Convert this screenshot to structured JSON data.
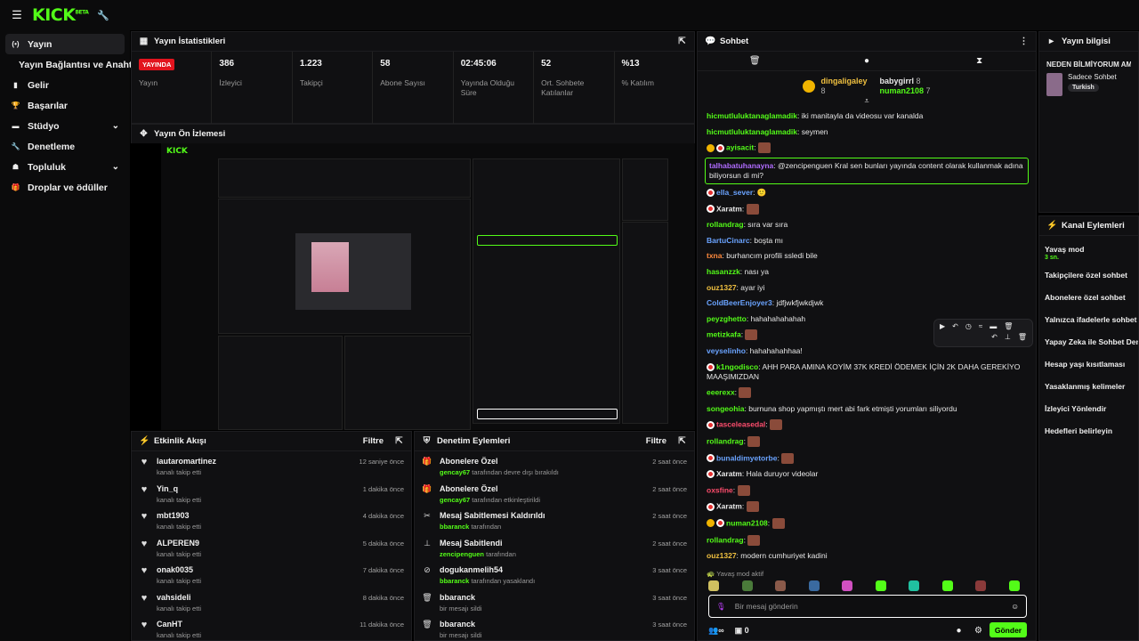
{
  "app": {
    "logo": "KICK",
    "logo_beta": "BETA"
  },
  "sidebar": {
    "items": [
      {
        "label": "Yayın",
        "icon": "broadcast-icon",
        "active": true
      },
      {
        "label": "Yayın Bağlantısı ve Anahtarı",
        "sub": true
      },
      {
        "label": "Gelir",
        "icon": "chart-icon"
      },
      {
        "label": "Başarılar",
        "icon": "trophy-icon"
      },
      {
        "label": "Stüdyo",
        "icon": "studio-icon",
        "chevron": true
      },
      {
        "label": "Denetleme",
        "icon": "wrench-icon"
      },
      {
        "label": "Topluluk",
        "icon": "community-icon",
        "chevron": true
      },
      {
        "label": "Droplar ve ödüller",
        "icon": "gift-icon"
      }
    ]
  },
  "stats_panel": {
    "title": "Yayın İstatistikleri",
    "live_badge": "YAYINDA",
    "items": [
      {
        "value": "",
        "label": "Yayın"
      },
      {
        "value": "386",
        "label": "İzleyici"
      },
      {
        "value": "1.223",
        "label": "Takipçi"
      },
      {
        "value": "58",
        "label": "Abone Sayısı"
      },
      {
        "value": "02:45:06",
        "label": "Yayında Olduğu Süre"
      },
      {
        "value": "52",
        "label": "Ort. Sohbete Katılanlar"
      },
      {
        "value": "%13",
        "label": "% Katılım"
      }
    ]
  },
  "preview_panel": {
    "title": "Yayın Ön İzlemesi"
  },
  "activity_feed": {
    "title": "Etkinlik Akışı",
    "filter": "Filtre",
    "rows": [
      {
        "name": "lautaromartinez",
        "sub": "kanalı takip etti",
        "time": "12 saniye önce"
      },
      {
        "name": "Yin_q",
        "sub": "kanalı takip etti",
        "time": "1 dakika önce"
      },
      {
        "name": "mbt1903",
        "sub": "kanalı takip etti",
        "time": "4 dakika önce"
      },
      {
        "name": "ALPEREN9",
        "sub": "kanalı takip etti",
        "time": "5 dakika önce"
      },
      {
        "name": "onak0035",
        "sub": "kanalı takip etti",
        "time": "7 dakika önce"
      },
      {
        "name": "vahsideli",
        "sub": "kanalı takip etti",
        "time": "8 dakika önce"
      },
      {
        "name": "CanHT",
        "sub": "kanalı takip etti",
        "time": "11 dakika önce"
      }
    ]
  },
  "mod_actions": {
    "title": "Denetim Eylemleri",
    "filter": "Filtre",
    "rows": [
      {
        "icon": "gift-icon",
        "name": "Abonelere Özel",
        "user": "gencay67",
        "sub": "tarafından devre dışı bırakıldı",
        "time": "2 saat önce"
      },
      {
        "icon": "gift-icon",
        "name": "Abonelere Özel",
        "user": "gencay67",
        "sub": "tarafından etkinleştirildi",
        "time": "2 saat önce"
      },
      {
        "icon": "unpin-icon",
        "name": "Mesaj Sabitlemesi Kaldırıldı",
        "user": "bbaranck",
        "sub": "tarafından",
        "time": "2 saat önce"
      },
      {
        "icon": "pin-icon",
        "name": "Mesaj Sabitlendi",
        "user": "zencipenguen",
        "sub": "tarafından",
        "time": "2 saat önce"
      },
      {
        "icon": "ban-icon",
        "name": "dogukanmelih54",
        "user": "bbaranck",
        "sub": "tarafından yasaklandı",
        "time": "3 saat önce"
      },
      {
        "icon": "trash-icon",
        "name": "bbaranck",
        "user": "",
        "sub": "bir mesajı sildi",
        "time": "3 saat önce"
      },
      {
        "icon": "trash-icon",
        "name": "bbaranck",
        "user": "",
        "sub": "bir mesajı sildi",
        "time": "3 saat önce"
      }
    ]
  },
  "chat": {
    "title": "Sohbet",
    "pinned": {
      "top_user": "dingaligaley",
      "top_count": "8",
      "users": [
        {
          "name": "babygirrl",
          "count": "8"
        },
        {
          "name": "numan2108",
          "count": "7"
        }
      ]
    },
    "messages": [
      {
        "user": "hicmutluluktanaglamadik",
        "color": "#53fc18",
        "text": "iki manitayla da videosu var kanalda"
      },
      {
        "user": "hicmutluluktanaglamadik",
        "color": "#53fc18",
        "text": "seymen"
      },
      {
        "user": "ayisacit",
        "color": "#53fc18",
        "text": "",
        "emote": true,
        "badges": [
          "y",
          "r"
        ]
      },
      {
        "user": "talhabatuhanayna",
        "color": "#b06cff",
        "text": "@zencipenguen Kral sen bunları yayında content olarak kullanmak adına biliyorsun di mi?",
        "highlight": true
      },
      {
        "user": "ella_sever",
        "color": "#6aa3ff",
        "text": "🙂",
        "badges": [
          "r"
        ]
      },
      {
        "user": "Xaratm",
        "color": "#e8e8e8",
        "text": "",
        "emote": true,
        "badges": [
          "r"
        ]
      },
      {
        "user": "rollandrag",
        "color": "#53fc18",
        "text": "sıra var sıra"
      },
      {
        "user": "BartuCinarc",
        "color": "#6aa3ff",
        "text": "boşta mı"
      },
      {
        "user": "txna",
        "color": "#ff8a3d",
        "text": "burhancım profili ssledi bile"
      },
      {
        "user": "hasanzzk",
        "color": "#53fc18",
        "text": "nası ya"
      },
      {
        "user": "ouz1327",
        "color": "#f0c040",
        "text": "ayar iyi"
      },
      {
        "user": "ColdBeerEnjoyer3",
        "color": "#6aa3ff",
        "text": "jdfjwkfjwkdjwk"
      },
      {
        "user": "peyzghetto",
        "color": "#53fc18",
        "text": "hahahahahahah"
      },
      {
        "user": "metizkafa",
        "color": "#53fc18",
        "text": "",
        "emote": true
      },
      {
        "user": "veyselinho",
        "color": "#6aa3ff",
        "text": "hahahahahhaa!"
      },
      {
        "user": "k1ngodisco",
        "color": "#53fc18",
        "text": "AHH PARA AMINA KOYİM 37K KREDİ ÖDEMEK İÇİN 2K DAHA GEREKİYO MAAŞIMIZDAN",
        "badges": [
          "r"
        ]
      },
      {
        "user": "eeerexx",
        "color": "#53fc18",
        "text": "",
        "emote": true
      },
      {
        "user": "songeohia",
        "color": "#53fc18",
        "text": "burnuna shop yapmıştı mert abi fark etmişti yorumları siliyordu"
      },
      {
        "user": "tasceleasedal",
        "color": "#ff4d6d",
        "text": "",
        "emote": true,
        "badges": [
          "r"
        ]
      },
      {
        "user": "rollandrag",
        "color": "#53fc18",
        "text": "",
        "emote": true
      },
      {
        "user": "bunaldimyetorbe",
        "color": "#6aa3ff",
        "text": "",
        "emote": true,
        "badges": [
          "r"
        ]
      },
      {
        "user": "Xaratm",
        "color": "#e8e8e8",
        "text": "Hala duruyor videolar",
        "badges": [
          "r"
        ]
      },
      {
        "user": "oxsfine",
        "color": "#ff4d6d",
        "text": "",
        "emote": true
      },
      {
        "user": "Xaratm",
        "color": "#e8e8e8",
        "text": "",
        "emote": true,
        "badges": [
          "r"
        ]
      },
      {
        "user": "numan2108",
        "color": "#53fc18",
        "text": "",
        "emote": true,
        "badges": [
          "y",
          "r"
        ]
      },
      {
        "user": "rollandrag",
        "color": "#53fc18",
        "text": "",
        "emote": true
      },
      {
        "user": "ouz1327",
        "color": "#f0c040",
        "text": "modern cumhuriyet kadini"
      }
    ],
    "slow_mode_notice": "Yavaş mod aktif",
    "input_placeholder": "Bir mesaj gönderin",
    "send_label": "Gönder",
    "viewer_count": "0"
  },
  "stream_info": {
    "title": "Yayın bilgisi",
    "stream_title": "NEDEN BİLMİYORUM AMA",
    "chat_mode": "Sadece Sohbet",
    "language": "Turkish"
  },
  "channel_actions": {
    "title": "Kanal Eylemleri",
    "items": [
      {
        "label": "Yavaş mod",
        "sub": "3 sn."
      },
      {
        "label": "Takipçilere özel sohbet"
      },
      {
        "label": "Abonelere özel sohbet"
      },
      {
        "label": "Yalnızca ifadelerle sohbet"
      },
      {
        "label": "Yapay Zeka ile Sohbet Denetimi"
      },
      {
        "label": "Hesap yaşı kısıtlaması"
      },
      {
        "label": "Yasaklanmış kelimeler"
      },
      {
        "label": "İzleyici Yönlendir"
      },
      {
        "label": "Hedefleri belirleyin"
      }
    ]
  },
  "colors": {
    "accent": "#53fc18",
    "live": "#e2141e",
    "bg": "#000000",
    "panel": "#101012"
  }
}
